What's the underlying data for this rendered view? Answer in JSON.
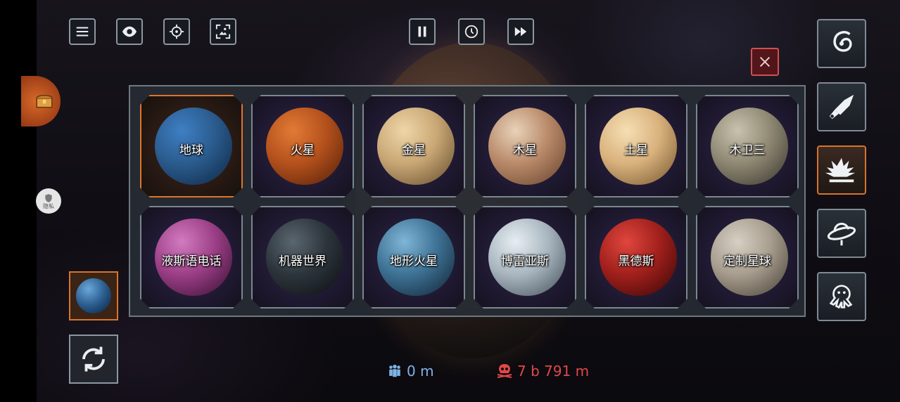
{
  "top_bar": {
    "left_buttons": [
      "menu-icon",
      "eye-icon",
      "crosshair-icon",
      "screenshot-icon"
    ],
    "center_buttons": [
      "pause-icon",
      "clock-icon",
      "fast-forward-icon"
    ]
  },
  "left_side": {
    "privacy_label": "隐私"
  },
  "planets": [
    {
      "name": "地球",
      "colors": [
        "#3e7fc4",
        "#2b5c8e",
        "#0f2a48"
      ],
      "selected": true
    },
    {
      "name": "火星",
      "colors": [
        "#e27a36",
        "#b4511c",
        "#5a220a"
      ],
      "selected": false
    },
    {
      "name": "金星",
      "colors": [
        "#efd6a8",
        "#c9a775",
        "#6a5130"
      ],
      "selected": false
    },
    {
      "name": "木星",
      "colors": [
        "#e8d2b8",
        "#b98a6a",
        "#6b4630"
      ],
      "selected": false
    },
    {
      "name": "土星",
      "colors": [
        "#f6dfb4",
        "#d9b27d",
        "#7c5a32"
      ],
      "selected": false
    },
    {
      "name": "木卫三",
      "colors": [
        "#c9c2ae",
        "#8f8873",
        "#3d3a31"
      ],
      "selected": false
    },
    {
      "name": "液斯语电话",
      "colors": [
        "#d27bc0",
        "#9c3f87",
        "#3d1236"
      ],
      "selected": false
    },
    {
      "name": "机器世界",
      "colors": [
        "#5a6670",
        "#2d353c",
        "#0c1014"
      ],
      "selected": false
    },
    {
      "name": "地形火星",
      "colors": [
        "#7fb5d6",
        "#3e7294",
        "#13283a"
      ],
      "selected": false
    },
    {
      "name": "博雷亚斯",
      "colors": [
        "#e6eef2",
        "#a9b6bf",
        "#4a565e"
      ],
      "selected": false
    },
    {
      "name": "黑德斯",
      "colors": [
        "#e0463e",
        "#a1201c",
        "#3e0807"
      ],
      "selected": false
    },
    {
      "name": "定制星球",
      "colors": [
        "#d6cfc3",
        "#a79d8e",
        "#4d463c"
      ],
      "selected": false
    }
  ],
  "right_tools": [
    "galaxy-icon",
    "missile-icon",
    "explosion-icon",
    "ufo-icon",
    "octopus-icon"
  ],
  "stats": {
    "population": "0 m",
    "deaths": "7 b 791 m",
    "population_color": "#7fb3e6",
    "deaths_color": "#e04848"
  },
  "colors": {
    "accent_orange": "#e0742a",
    "close_red": "#d05050"
  }
}
